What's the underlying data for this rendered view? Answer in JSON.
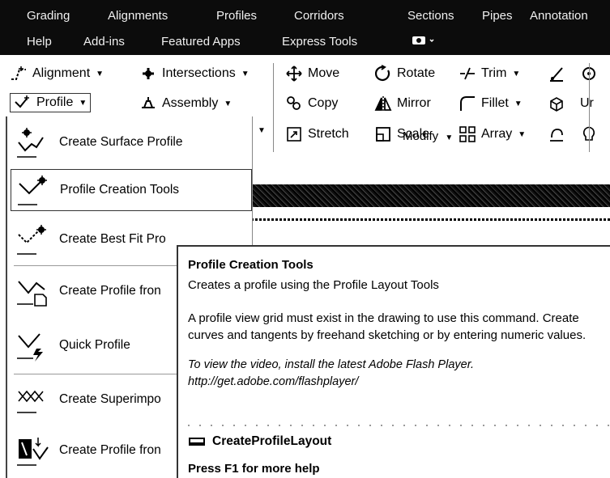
{
  "menubar": {
    "row1": [
      "Grading",
      "Alignments",
      "Profiles",
      "Corridors",
      "Sections",
      "Pipes",
      "Annotation"
    ],
    "row2": [
      "Help",
      "Add-ins",
      "Featured Apps",
      "Express Tools"
    ],
    "extra": "▲ •"
  },
  "ribbon": {
    "alignment": "Alignment",
    "intersections": "Intersections",
    "profile": "Profile",
    "assembly": "Assembly",
    "move": "Move",
    "rotate": "Rotate",
    "trim": "Trim",
    "copy": "Copy",
    "mirror": "Mirror",
    "fillet": "Fillet",
    "stretch": "Stretch",
    "scale": "Scale",
    "array": "Array",
    "modify_panel": "Modify",
    "ur_partial": "Ur"
  },
  "dropdown": {
    "items": [
      {
        "label": "Create Surface Profile",
        "icon": "surface-profile-icon"
      },
      {
        "label": "Profile Creation Tools",
        "icon": "profile-creation-tools-icon"
      },
      {
        "label": "Create Best Fit Pro",
        "icon": "best-fit-profile-icon"
      },
      {
        "label": "Create Profile fron",
        "icon": "profile-from-file-icon"
      },
      {
        "label": "Quick Profile",
        "icon": "quick-profile-icon"
      },
      {
        "label": "Create Superimpo",
        "icon": "superimposed-profile-icon"
      },
      {
        "label": "Create Profile fron",
        "icon": "profile-from-corridor-icon"
      }
    ]
  },
  "tooltip": {
    "title": "Profile Creation Tools",
    "subtitle": "Creates a profile using the Profile Layout Tools",
    "body": "A profile view grid must exist in the drawing to use this command. Create curves and tangents by freehand sketching or by entering numeric values.",
    "video_line1": "To view the video, install the latest Adobe Flash Player.",
    "video_line2": "http://get.adobe.com/flashplayer/",
    "command": "CreateProfileLayout",
    "help": "Press F1 for more help"
  }
}
